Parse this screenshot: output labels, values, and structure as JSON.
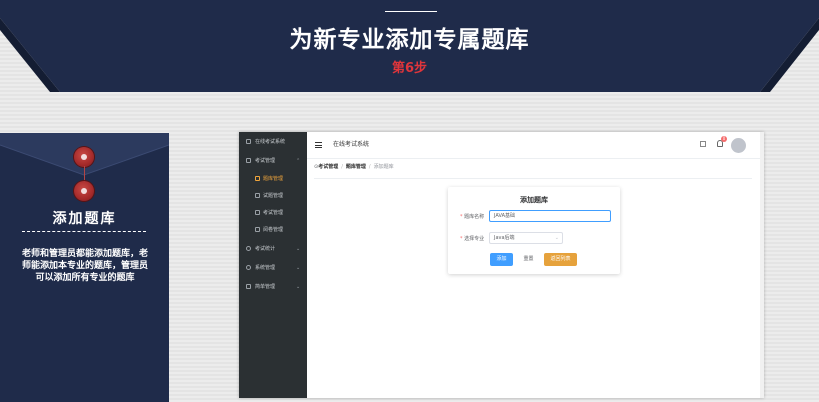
{
  "slide": {
    "title": "为新专业添加专属题库",
    "step": "第6步"
  },
  "card": {
    "title": "添加题库",
    "description": "老师和管理员都能添加题库，老师能添加本专业的题库，管理员可以添加所有专业的题库"
  },
  "app": {
    "sidebar": {
      "items": [
        {
          "label": "在线考试系统"
        },
        {
          "label": "考试管理"
        },
        {
          "label": "题库管理"
        },
        {
          "label": "试题管理"
        },
        {
          "label": "考试管理"
        },
        {
          "label": "阅卷管理"
        },
        {
          "label": "考试统计"
        },
        {
          "label": "系统管理"
        },
        {
          "label": "简单管理"
        }
      ]
    },
    "header": {
      "title": "在线考试系统",
      "notification_count": "0"
    },
    "breadcrumb": [
      "考试管理",
      "题库管理",
      "添加题库"
    ],
    "form": {
      "title": "添加题库",
      "name_label": "题库名称",
      "name_value": "JAVA基础",
      "major_label": "选择专业",
      "major_value": "Java后端",
      "add_button": "添加",
      "reset_button": "重置",
      "back_button": "返回列表"
    }
  },
  "colors": {
    "banner": "#1f2b4a",
    "accent_red": "#e0353b",
    "primary": "#409eff",
    "warning": "#e6a23c",
    "sidebar_bg": "#2b3033",
    "sidebar_active": "#f0a53c"
  }
}
